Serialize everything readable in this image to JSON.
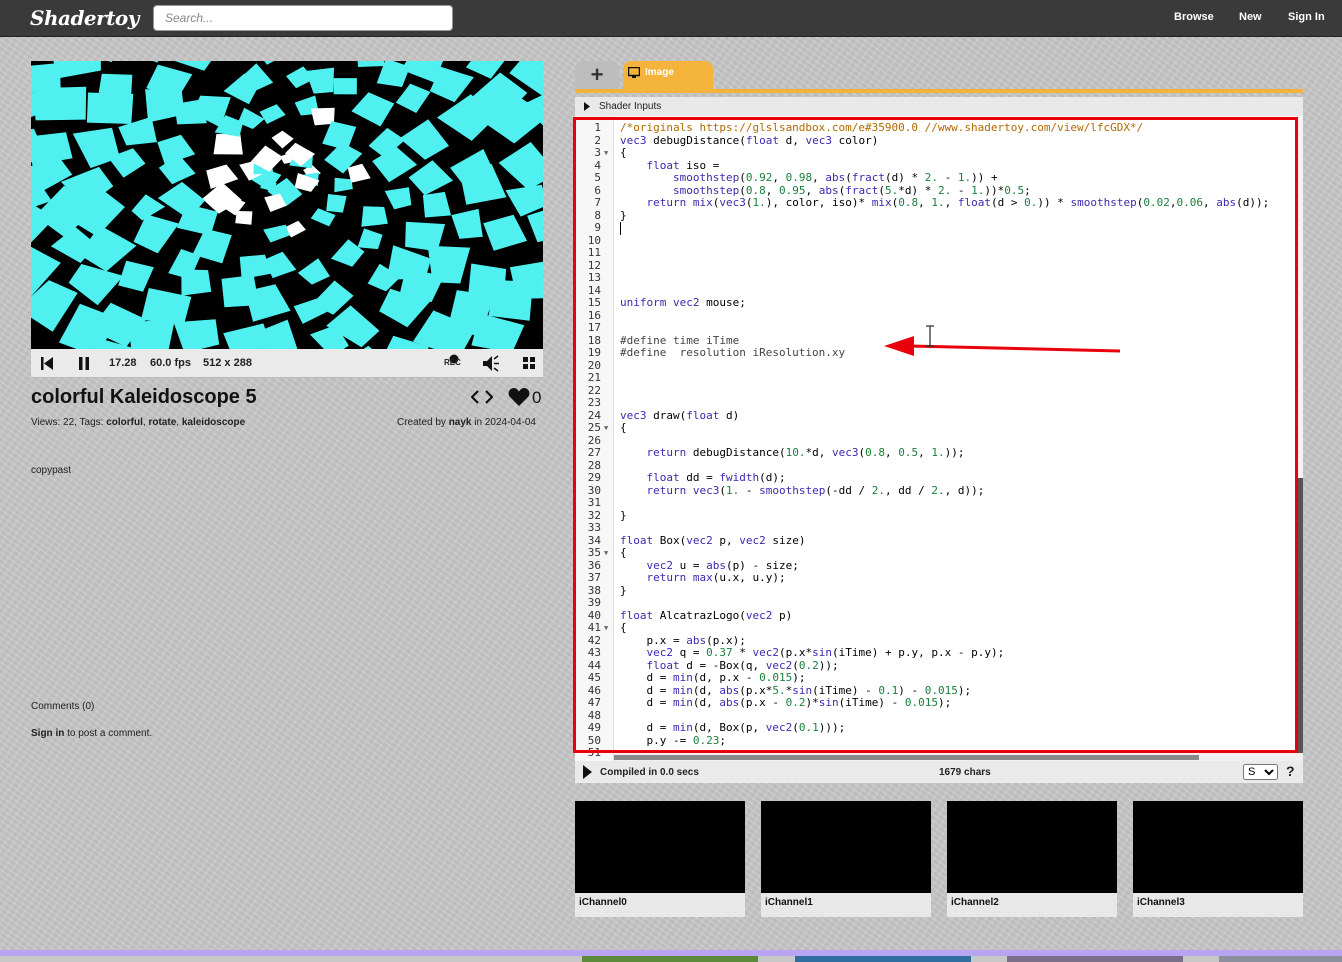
{
  "header": {
    "logo": "Shadertoy",
    "search_placeholder": "Search...",
    "nav": {
      "browse": "Browse",
      "new": "New",
      "sign_in": "Sign In"
    }
  },
  "player": {
    "time": "17.28",
    "fps": "60.0 fps",
    "resolution": "512 x 288",
    "rec_label": "REC"
  },
  "shader": {
    "title": "colorful Kaleidoscope 5",
    "likes": "0",
    "views_text": "Views: 22, Tags: ",
    "tags": [
      "colorful",
      "rotate",
      "kaleidoscope"
    ],
    "created_prefix": "Created by ",
    "author": "nayk",
    "created_suffix": " in 2024-04-04",
    "description": "copypast"
  },
  "comments": {
    "title": "Comments (0)",
    "sign_in": "Sign in",
    "sign_in_suffix": " to post a comment."
  },
  "tabs": {
    "add": "+",
    "image": "Image"
  },
  "shader_inputs_label": "Shader Inputs",
  "editor": {
    "lines": [
      {
        "n": "1",
        "fold": false,
        "text": "/*originals https://glslsandbox.com/e#35900.0 //www.shadertoy.com/view/lfcGDX*/"
      },
      {
        "n": "2",
        "fold": false,
        "text": "vec3 debugDistance(float d, vec3 color)"
      },
      {
        "n": "3",
        "fold": true,
        "text": "{"
      },
      {
        "n": "4",
        "fold": false,
        "text": "    float iso ="
      },
      {
        "n": "5",
        "fold": false,
        "text": "        smoothstep(0.92, 0.98, abs(fract(d) * 2. - 1.)) +"
      },
      {
        "n": "6",
        "fold": false,
        "text": "        smoothstep(0.8, 0.95, abs(fract(5.*d) * 2. - 1.))*0.5;"
      },
      {
        "n": "7",
        "fold": false,
        "text": "    return mix(vec3(1.), color, iso)* mix(0.8, 1., float(d > 0.)) * smoothstep(0.02,0.06, abs(d));"
      },
      {
        "n": "8",
        "fold": false,
        "text": "}"
      },
      {
        "n": "9",
        "fold": false,
        "text": ""
      },
      {
        "n": "10",
        "fold": false,
        "text": ""
      },
      {
        "n": "11",
        "fold": false,
        "text": ""
      },
      {
        "n": "12",
        "fold": false,
        "text": ""
      },
      {
        "n": "13",
        "fold": false,
        "text": ""
      },
      {
        "n": "14",
        "fold": false,
        "text": ""
      },
      {
        "n": "15",
        "fold": false,
        "text": "uniform vec2 mouse;"
      },
      {
        "n": "16",
        "fold": false,
        "text": ""
      },
      {
        "n": "17",
        "fold": false,
        "text": ""
      },
      {
        "n": "18",
        "fold": false,
        "text": "#define time iTime"
      },
      {
        "n": "19",
        "fold": false,
        "text": "#define  resolution iResolution.xy"
      },
      {
        "n": "20",
        "fold": false,
        "text": ""
      },
      {
        "n": "21",
        "fold": false,
        "text": ""
      },
      {
        "n": "22",
        "fold": false,
        "text": ""
      },
      {
        "n": "23",
        "fold": false,
        "text": ""
      },
      {
        "n": "24",
        "fold": false,
        "text": "vec3 draw(float d)"
      },
      {
        "n": "25",
        "fold": true,
        "text": "{"
      },
      {
        "n": "26",
        "fold": false,
        "text": ""
      },
      {
        "n": "27",
        "fold": false,
        "text": "    return debugDistance(10.*d, vec3(0.8, 0.5, 1.));"
      },
      {
        "n": "28",
        "fold": false,
        "text": ""
      },
      {
        "n": "29",
        "fold": false,
        "text": "    float dd = fwidth(d);"
      },
      {
        "n": "30",
        "fold": false,
        "text": "    return vec3(1. - smoothstep(-dd / 2., dd / 2., d));"
      },
      {
        "n": "31",
        "fold": false,
        "text": ""
      },
      {
        "n": "32",
        "fold": false,
        "text": "}"
      },
      {
        "n": "33",
        "fold": false,
        "text": ""
      },
      {
        "n": "34",
        "fold": false,
        "text": "float Box(vec2 p, vec2 size)"
      },
      {
        "n": "35",
        "fold": true,
        "text": "{"
      },
      {
        "n": "36",
        "fold": false,
        "text": "    vec2 u = abs(p) - size;"
      },
      {
        "n": "37",
        "fold": false,
        "text": "    return max(u.x, u.y);"
      },
      {
        "n": "38",
        "fold": false,
        "text": "}"
      },
      {
        "n": "39",
        "fold": false,
        "text": ""
      },
      {
        "n": "40",
        "fold": false,
        "text": "float AlcatrazLogo(vec2 p)"
      },
      {
        "n": "41",
        "fold": true,
        "text": "{"
      },
      {
        "n": "42",
        "fold": false,
        "text": "    p.x = abs(p.x);"
      },
      {
        "n": "43",
        "fold": false,
        "text": "    vec2 q = 0.37 * vec2(p.x*sin(iTime) + p.y, p.x - p.y);"
      },
      {
        "n": "44",
        "fold": false,
        "text": "    float d = -Box(q, vec2(0.2));"
      },
      {
        "n": "45",
        "fold": false,
        "text": "    d = min(d, p.x - 0.015);"
      },
      {
        "n": "46",
        "fold": false,
        "text": "    d = min(d, abs(p.x*5.*sin(iTime) - 0.1) - 0.015);"
      },
      {
        "n": "47",
        "fold": false,
        "text": "    d = min(d, abs(p.x - 0.2)*sin(iTime) - 0.015);"
      },
      {
        "n": "48",
        "fold": false,
        "text": ""
      },
      {
        "n": "49",
        "fold": false,
        "text": "    d = min(d, Box(p, vec2(0.1)));"
      },
      {
        "n": "50",
        "fold": false,
        "text": "    p.y -= 0.23;"
      },
      {
        "n": "51",
        "fold": false,
        "text": ""
      }
    ]
  },
  "status": {
    "compiled": "Compiled in 0.0 secs",
    "chars": "1679 chars",
    "font_size_option": "S",
    "help": "?"
  },
  "channels": [
    "iChannel0",
    "iChannel1",
    "iChannel2",
    "iChannel3"
  ],
  "colors": {
    "accent": "#f4b43c",
    "highlight": "#e8000b",
    "kaleido": "#4ff0ef"
  },
  "icons": {
    "rewind": "skip-back-icon",
    "pause": "pause-icon",
    "rec": "record-icon",
    "volume": "volume-icon",
    "fullscreen": "fullscreen-icon",
    "code": "code-icon",
    "heart": "heart-icon",
    "image_tab": "monitor-icon",
    "play": "play-icon"
  }
}
